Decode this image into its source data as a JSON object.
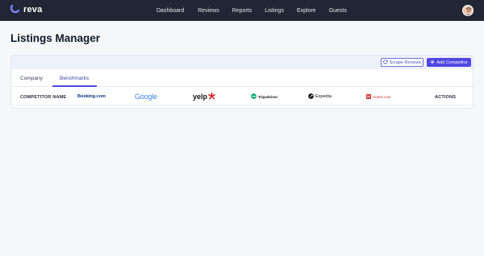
{
  "app": {
    "name": "reva"
  },
  "nav": {
    "items": [
      "Dashboard",
      "Reviews",
      "Reports",
      "Listings",
      "Explore",
      "Guests"
    ]
  },
  "page": {
    "title": "Listings Manager"
  },
  "toolbar": {
    "scrape_label": "Scrape Reviews",
    "add_label": "Add Competitor",
    "accent": "#4f46e5"
  },
  "tabs": [
    {
      "label": "Company"
    },
    {
      "label": "Benchmarks",
      "active": true
    }
  ],
  "table": {
    "name_header": "COMPETITOR NAME",
    "actions_header": "ACTIONS",
    "brands": {
      "booking": "Booking.com",
      "google": "Google",
      "yelp": "yelp",
      "tripadvisor": "Tripadvisor",
      "expedia": "Expedia",
      "hotels": "Hotels.com"
    }
  },
  "icons": [
    "reva-logo-icon",
    "user-avatar",
    "refresh-icon",
    "plus-icon",
    "yelp-burst-icon",
    "tripadvisor-owl-icon",
    "expedia-plane-icon",
    "hotels-h-icon"
  ]
}
